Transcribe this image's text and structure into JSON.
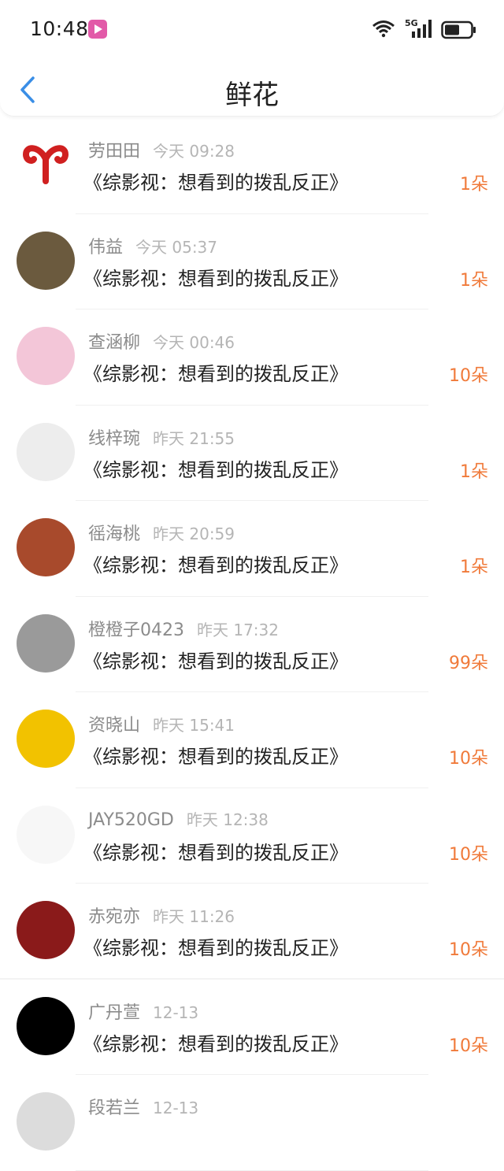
{
  "status_bar": {
    "time": "10:48",
    "network": "5G"
  },
  "header": {
    "title": "鲜花"
  },
  "items": [
    {
      "name": "劳田田",
      "time": "今天 09:28",
      "book": "《综影视：想看到的拨乱反正》",
      "count": "1朵",
      "avatar_color": "#ffffff"
    },
    {
      "name": "伟益",
      "time": "今天 05:37",
      "book": "《综影视：想看到的拨乱反正》",
      "count": "1朵",
      "avatar_color": "#6b5a3e"
    },
    {
      "name": "查涵柳",
      "time": "今天 00:46",
      "book": "《综影视：想看到的拨乱反正》",
      "count": "10朵",
      "avatar_color": "#f3c6d8"
    },
    {
      "name": "线梓琬",
      "time": "昨天 21:55",
      "book": "《综影视：想看到的拨乱反正》",
      "count": "1朵",
      "avatar_color": "#ededed"
    },
    {
      "name": "徭海桃",
      "time": "昨天 20:59",
      "book": "《综影视：想看到的拨乱反正》",
      "count": "1朵",
      "avatar_color": "#a84a2c"
    },
    {
      "name": "橙橙子0423",
      "time": "昨天 17:32",
      "book": "《综影视：想看到的拨乱反正》",
      "count": "99朵",
      "avatar_color": "#9a9a9a"
    },
    {
      "name": "资晓山",
      "time": "昨天 15:41",
      "book": "《综影视：想看到的拨乱反正》",
      "count": "10朵",
      "avatar_color": "#f2c200"
    },
    {
      "name": "JAY520GD",
      "time": "昨天 12:38",
      "book": "《综影视：想看到的拨乱反正》",
      "count": "10朵",
      "avatar_color": "#f7f7f7"
    },
    {
      "name": "赤宛亦",
      "time": "昨天 11:26",
      "book": "《综影视：想看到的拨乱反正》",
      "count": "10朵",
      "avatar_color": "#8a1a1a"
    },
    {
      "name": "广丹萱",
      "time": "12-13",
      "book": "《综影视：想看到的拨乱反正》",
      "count": "10朵",
      "avatar_color": "#000000"
    },
    {
      "name": "段若兰",
      "time": "12-13",
      "book": "",
      "count": "",
      "avatar_color": "#dcdcdc"
    }
  ]
}
